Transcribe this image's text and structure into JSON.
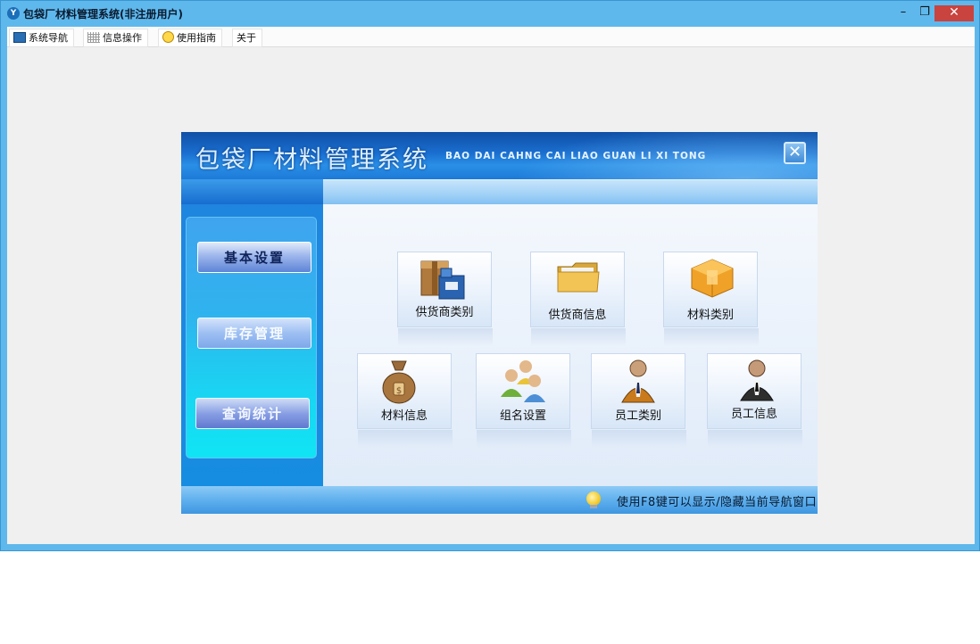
{
  "window": {
    "title": "包袋厂材料管理系统(非注册用户)",
    "controls": {
      "minimize": "–",
      "restore": "❐",
      "close": "✕"
    }
  },
  "menu": {
    "items": [
      {
        "label": "系统导航",
        "icon": "navigation-icon"
      },
      {
        "label": "信息操作",
        "icon": "grid-icon"
      },
      {
        "label": "使用指南",
        "icon": "guide-icon"
      },
      {
        "label": "关于",
        "icon": ""
      }
    ]
  },
  "banner": {
    "title_cn": "包袋厂材料管理系统",
    "title_en": "BAO DAI CAHNG CAI LIAO GUAN LI XI TONG",
    "close_glyph": "✕"
  },
  "sidebar": {
    "buttons": [
      {
        "label": "基本设置"
      },
      {
        "label": "库存管理"
      },
      {
        "label": "查询统计"
      }
    ]
  },
  "tiles": [
    {
      "label": "供货商类别",
      "icon": "supplier-category-icon"
    },
    {
      "label": "供货商信息",
      "icon": "folder-icon"
    },
    {
      "label": "材料类别",
      "icon": "box-icon"
    },
    {
      "label": "材料信息",
      "icon": "money-bag-icon"
    },
    {
      "label": "组名设置",
      "icon": "group-users-icon"
    },
    {
      "label": "员工类别",
      "icon": "employee-icon"
    },
    {
      "label": "员工信息",
      "icon": "employee-suit-icon"
    }
  ],
  "footer": {
    "hint": "使用F8键可以显示/隐藏当前导航窗口",
    "icon": "lightbulb-icon"
  }
}
